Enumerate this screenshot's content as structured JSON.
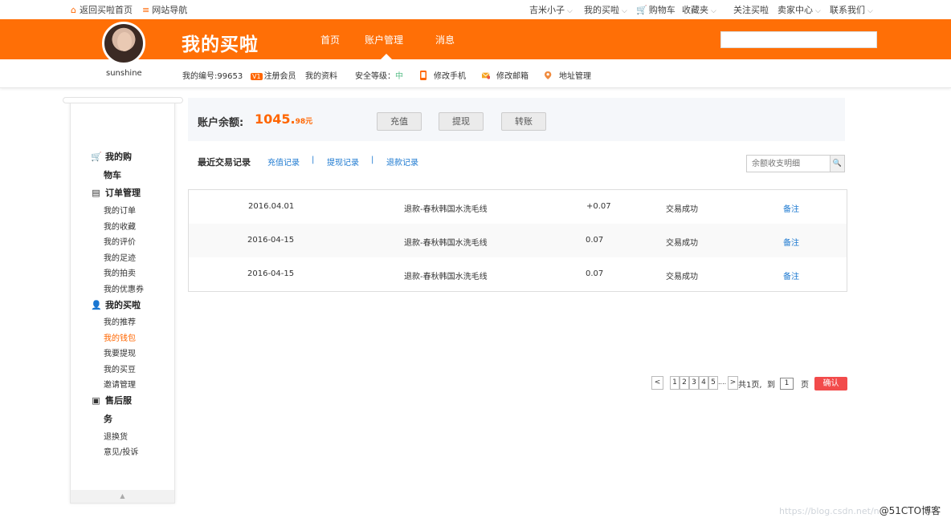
{
  "topbar": {
    "home": "返回买啦首页",
    "site_nav": "网站导航",
    "user": "吉米小子",
    "my_mail": "我的买啦",
    "cart": "购物车",
    "favorites": "收藏夹",
    "follow": "关注买啦",
    "seller": "卖家中心",
    "contact": "联系我们"
  },
  "header": {
    "brand": "我的买啦",
    "nav": [
      "首页",
      "账户管理",
      "消息"
    ],
    "search_placeholder": ""
  },
  "subheader": {
    "username": "sunshine",
    "member_id": "我的编号:99653",
    "vip_badge": "V1",
    "register": "注册会员",
    "profile": "我的资料",
    "security_label": "安全等级：",
    "security_level": "中",
    "change_phone": "修改手机",
    "change_email": "修改邮箱",
    "address": "地址管理"
  },
  "sidebar": {
    "groups": [
      {
        "title": "我的购",
        "title2": "物车",
        "icon": "cart-icon",
        "items": []
      },
      {
        "title": "订单管理",
        "icon": "document-icon",
        "items": [
          "我的订单",
          "我的收藏",
          "我的评价",
          "我的足迹",
          "我的拍卖",
          "我的优惠券"
        ]
      },
      {
        "title": "我的买啦",
        "icon": "user-icon",
        "items": [
          "我的推荐",
          "我的钱包",
          "我要提现",
          "我的买豆",
          "邀请管理"
        ]
      },
      {
        "title": "售后服",
        "title2": "务",
        "icon": "id-card-icon",
        "items": [
          "退换货",
          "意见/投诉"
        ]
      }
    ],
    "active_item": "我的钱包"
  },
  "balance": {
    "label": "账户余额:",
    "amount_main": "1045.",
    "amount_minor": "98元",
    "buttons": [
      "充值",
      "提现",
      "转账"
    ]
  },
  "records": {
    "title": "最近交易记录",
    "tabs": [
      "充值记录",
      "提现记录",
      "退款记录"
    ],
    "separator": "|",
    "search_placeholder": "余额收支明细",
    "rows": [
      {
        "date": "2016.04.01",
        "desc": "退款-春秋韩国水洗毛线",
        "amount": "+0.07",
        "status": "交易成功",
        "note": "备注"
      },
      {
        "date": "2016-04-15",
        "desc": "退款-春秋韩国水洗毛线",
        "amount": "0.07",
        "status": "交易成功",
        "note": "备注"
      },
      {
        "date": "2016-04-15",
        "desc": "退款-春秋韩国水洗毛线",
        "amount": "0.07",
        "status": "交易成功",
        "note": "备注"
      }
    ]
  },
  "pagination": {
    "prev": "<",
    "pages": [
      "1",
      "2",
      "3",
      "4",
      "5"
    ],
    "ellipsis": "....",
    "next": ">",
    "total": "共1页,",
    "goto": "到",
    "page_value": "1",
    "page_unit": "页",
    "confirm": "确认"
  },
  "watermark": {
    "url": "https://blog.csdn.net/n",
    "brand": "@51CTO博客"
  },
  "colors": {
    "accent": "#ff6f06",
    "link": "#1e7ad1",
    "confirm": "#f24b4b"
  }
}
